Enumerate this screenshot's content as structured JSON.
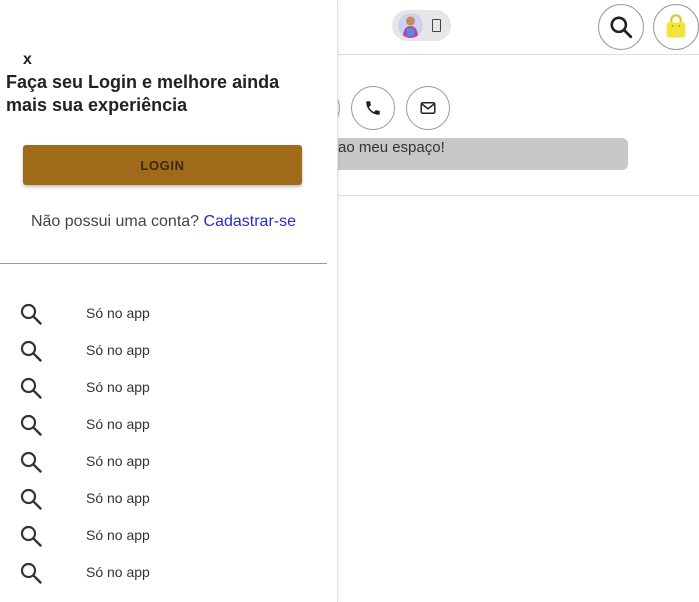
{
  "drawer": {
    "close_label": "x",
    "title": "Faça seu Login e melhore ainda mais sua experiência",
    "login_label": "LOGIN",
    "signup_prompt": "Não possui uma conta?",
    "signup_link": "Cadastrar-se",
    "menu_items": [
      {
        "label": "Só no app",
        "icon": "search-icon"
      },
      {
        "label": "Só no app",
        "icon": "search-icon"
      },
      {
        "label": "Só no app",
        "icon": "search-icon"
      },
      {
        "label": "Só no app",
        "icon": "search-icon"
      },
      {
        "label": "Só no app",
        "icon": "search-icon"
      },
      {
        "label": "Só no app",
        "icon": "search-icon"
      },
      {
        "label": "Só no app",
        "icon": "search-icon"
      },
      {
        "label": "Só no app",
        "icon": "search-icon"
      }
    ]
  },
  "background": {
    "message_text": "ao meu espaço!",
    "header_icons": [
      "avatar",
      "search-icon",
      "shopping-bag-icon"
    ],
    "contact_icons": [
      "phone-icon",
      "email-icon"
    ]
  },
  "colors": {
    "login_button": "#a06a1b",
    "link": "#2a2acb",
    "bag_icon": "#f3e33a",
    "message_bar": "#c8c8c8"
  }
}
